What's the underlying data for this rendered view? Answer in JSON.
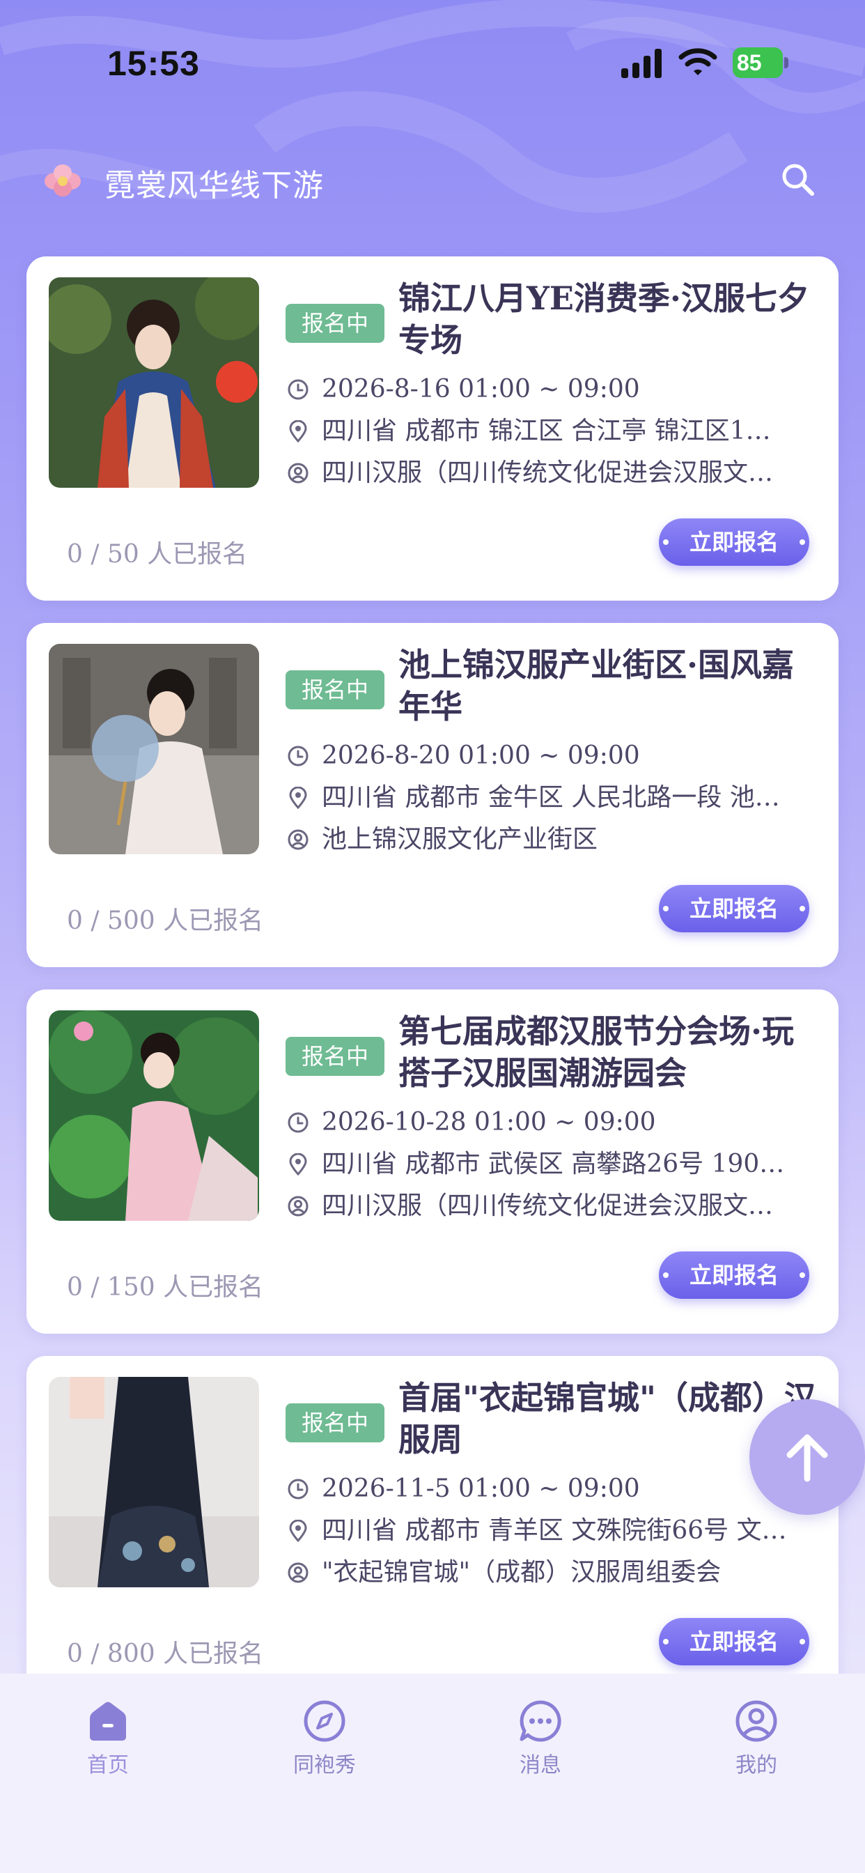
{
  "status_bar": {
    "time": "15:53",
    "battery": "85"
  },
  "header": {
    "title": "霓裳风华线下游",
    "logo_icon": "flower-icon",
    "search_icon": "search-icon"
  },
  "colors": {
    "accent": "#7a70f0",
    "badge": "#6fbb93",
    "title_text": "#3a3457"
  },
  "events": [
    {
      "badge": "报名中",
      "title": "锦江八月YE消费季·汉服七夕专场",
      "time": "2026-8-16 01:00 ~ 09:00",
      "location": "四川省 成都市 锦江区 合江亭 锦江区1…",
      "organizer": "四川汉服（四川传统文化促进会汉服文…",
      "signup_count": "0 / 50 人已报名",
      "button": "立即报名"
    },
    {
      "badge": "报名中",
      "title": "池上锦汉服产业街区·国风嘉年华",
      "time": "2026-8-20 01:00 ~ 09:00",
      "location": "四川省 成都市 金牛区 人民北路一段 池…",
      "organizer": "池上锦汉服文化产业街区",
      "signup_count": "0 / 500 人已报名",
      "button": "立即报名"
    },
    {
      "badge": "报名中",
      "title": "第七届成都汉服节分会场·玩搭子汉服国潮游园会",
      "time": "2026-10-28 01:00 ~ 09:00",
      "location": "四川省 成都市 武侯区 高攀路26号 190…",
      "organizer": "四川汉服（四川传统文化促进会汉服文…",
      "signup_count": "0 / 150 人已报名",
      "button": "立即报名"
    },
    {
      "badge": "报名中",
      "title": "首届\"衣起锦官城\"（成都）汉服周",
      "time": "2026-11-5 01:00 ~ 09:00",
      "location": "四川省 成都市 青羊区 文殊院街66号 文…",
      "organizer": "\"衣起锦官城\"（成都）汉服周组委会",
      "signup_count": "0 / 800 人已报名",
      "button": "立即报名"
    }
  ],
  "tabs": [
    {
      "label": "首页",
      "icon": "home-icon",
      "active": true
    },
    {
      "label": "同袍秀",
      "icon": "compass-icon",
      "active": false
    },
    {
      "label": "消息",
      "icon": "chat-icon",
      "active": false
    },
    {
      "label": "我的",
      "icon": "profile-icon",
      "active": false
    }
  ]
}
